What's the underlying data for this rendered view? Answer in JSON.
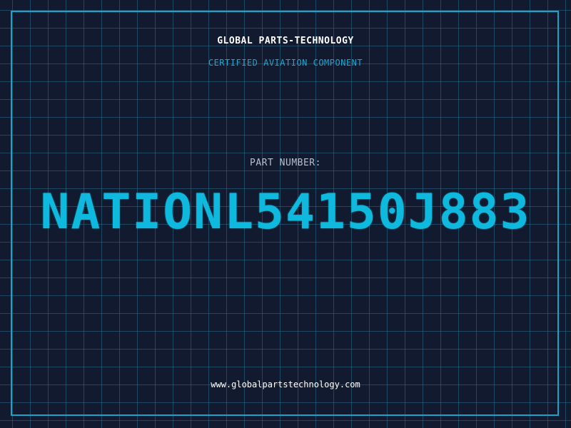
{
  "header": {
    "company": "GLOBAL PARTS-TECHNOLOGY",
    "tagline": "CERTIFIED AVIATION COMPONENT"
  },
  "part": {
    "label": "PART NUMBER:",
    "number": "NATIONL54150J883"
  },
  "footer": {
    "url": "www.globalpartstechnology.com"
  },
  "colors": {
    "background": "#111a2e",
    "grid": "#286e8c",
    "accent": "#0fb8dd",
    "frame": "#1aa3c8"
  }
}
